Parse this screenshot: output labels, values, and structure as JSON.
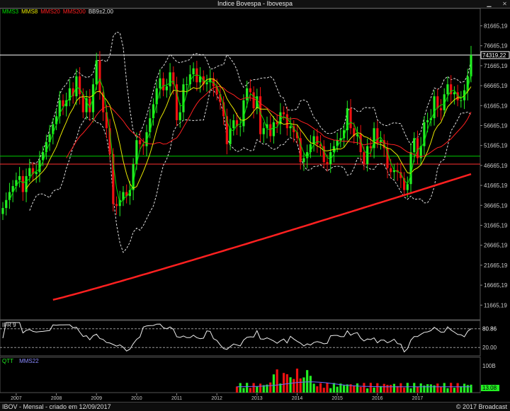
{
  "window": {
    "title": "Indice Bovespa - Ibovespa",
    "minimize_icon": "minimize-icon",
    "close_icon": "close-icon"
  },
  "legend": {
    "mms3": "MMS3",
    "mms8": "MMS8",
    "mms20": "MMS20",
    "mms200": "MMS200",
    "bb": "BB9±2,00"
  },
  "colors": {
    "mms3": "#00dd00",
    "mms8": "#e8e800",
    "mms20": "#ff2020",
    "mms200": "#ff2020",
    "bb": "#dddddd",
    "up_candle": "#22ee22",
    "down_candle": "#ee1111",
    "level_green": "#00cc00",
    "level_red": "#ff3030",
    "level_white": "#ffffff",
    "volume_avg": "#6a6aff"
  },
  "footer": {
    "left": "IBOV - Mensal - criado em 12/09/2017",
    "right": "© 2017 Broadcast"
  },
  "chart_data": [
    {
      "type": "candlestick",
      "title": "Indice Bovespa - Ibovespa",
      "y_ticks": [
        "81665,19",
        "76665,19",
        "71665,19",
        "66665,19",
        "61665,19",
        "56665,19",
        "51665,19",
        "46665,19",
        "41665,19",
        "36665,19",
        "31665,19",
        "26665,19",
        "21665,19",
        "16665,19",
        "11665,19"
      ],
      "ylim": [
        8000,
        86000
      ],
      "x_ticks": [
        "2007",
        "2008",
        "2009",
        "2010",
        "2011",
        "2012",
        "2013",
        "2014",
        "2015",
        "2016",
        "2017"
      ],
      "last_value_label": "74319,22",
      "levels": {
        "green": 49000,
        "red": 47000,
        "white": 74319
      },
      "series_names": [
        "MMS3",
        "MMS8",
        "MMS20",
        "MMS200",
        "BB9±2,00"
      ],
      "closes_monthly_approx": [
        36000,
        38000,
        40000,
        41500,
        43000,
        44000,
        40000,
        44000,
        46000,
        44500,
        45000,
        48000,
        50000,
        52500,
        54500,
        57000,
        59000,
        63000,
        61500,
        63000,
        66000,
        64000,
        69000,
        64500,
        60000,
        63500,
        60000,
        67000,
        73000,
        65000,
        60000,
        56000,
        49500,
        37000,
        36500,
        38000,
        40000,
        39000,
        40500,
        47000,
        53000,
        52000,
        51500,
        55000,
        58500,
        62000,
        66000,
        68500,
        65500,
        66500,
        70000,
        67000,
        58000,
        60000,
        67000,
        67000,
        69500,
        71000,
        67500,
        69000,
        67000,
        67500,
        68500,
        66500,
        64500,
        62500,
        59000,
        52000,
        56000,
        58000,
        56500,
        56500,
        63000,
        66000,
        65000,
        61000,
        64000,
        54500,
        56000,
        57000,
        54000,
        57500,
        57000,
        60000,
        59500,
        56000,
        56500,
        55000,
        53500,
        47500,
        48500,
        50000,
        52000,
        54000,
        52000,
        51500,
        47500,
        47000,
        50000,
        51500,
        53000,
        53500,
        55500,
        61000,
        56000,
        54000,
        54500,
        50000,
        47000,
        51500,
        51000,
        56000,
        52500,
        53000,
        51000,
        46000,
        45000,
        45500,
        45000,
        43500,
        40500,
        42000,
        50000,
        53500,
        48500,
        51500,
        57500,
        58000,
        58500,
        64000,
        61000,
        60500,
        64500,
        67000,
        64500,
        65000,
        63000,
        63000,
        65500,
        69000,
        74319
      ],
      "mms200_range": [
        13000,
        44500
      ],
      "indicators": {
        "ifr": {
          "name": "IFR 9",
          "value_label": "80.86",
          "level_label": "20.00",
          "ylim": [
            0,
            100
          ],
          "level": 20
        },
        "volume": {
          "name": "QTT",
          "avg_name": "MMS22",
          "scale_label": "100B",
          "value_label": "13.08"
        }
      }
    }
  ]
}
